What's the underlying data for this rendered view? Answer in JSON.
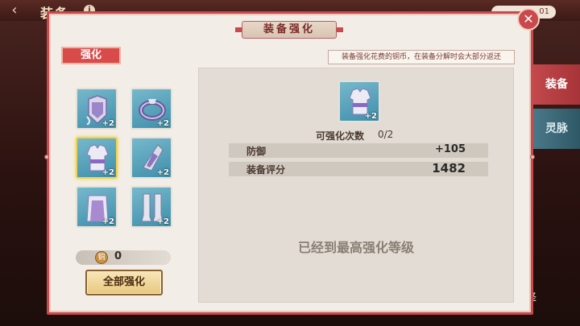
{
  "background": {
    "back_icon": "‹",
    "title": "装备",
    "info_icon": "i",
    "counter": "01",
    "side_tabs": [
      "装备",
      "灵脉"
    ],
    "bottom_char": "择"
  },
  "panel": {
    "title": "装备强化",
    "close_icon": "✕",
    "tab_label": "强化",
    "hint": "装备强化花费的铜币，在装备分解时会大部分返还"
  },
  "items": [
    {
      "name": "helmet",
      "level": "+2",
      "selected": false
    },
    {
      "name": "bracelet",
      "level": "+2",
      "selected": false
    },
    {
      "name": "armor",
      "level": "+2",
      "selected": true
    },
    {
      "name": "gauntlet",
      "level": "+2",
      "selected": false
    },
    {
      "name": "robe",
      "level": "+2",
      "selected": false
    },
    {
      "name": "boots",
      "level": "+2",
      "selected": false
    }
  ],
  "coins": {
    "icon": "铜",
    "value": "0"
  },
  "all_button": "全部强化",
  "detail": {
    "item_level": "+2",
    "times_label": "可强化次数",
    "times_value": "0/2",
    "stats": [
      {
        "label": "防御",
        "value": "+105"
      },
      {
        "label": "装备评分",
        "value": "1482"
      }
    ],
    "max_message": "已经到最高强化等级"
  },
  "colors": {
    "accent_red": "#c9494d",
    "item_bg": "#3f8fab",
    "selected_border": "#f2d34a"
  }
}
